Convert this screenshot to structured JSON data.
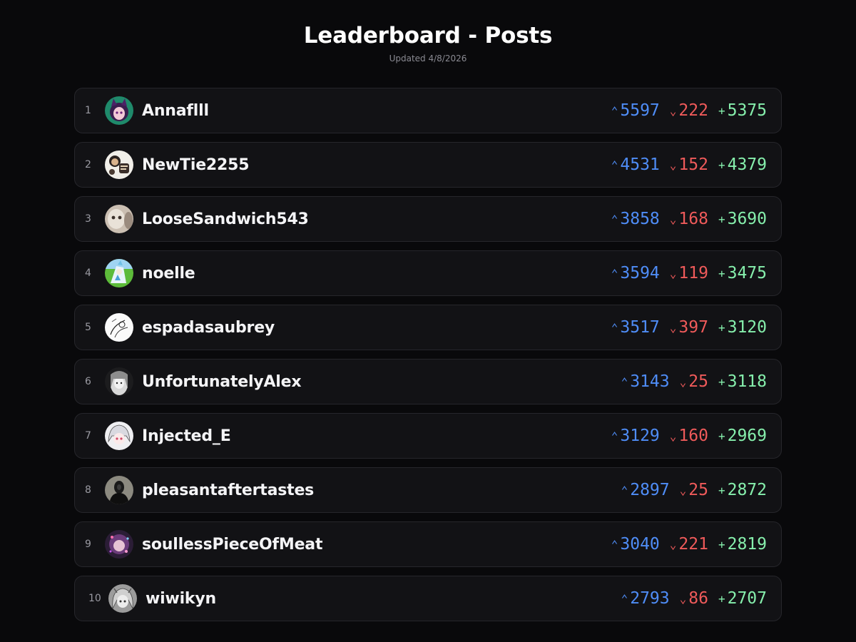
{
  "header": {
    "title": "Leaderboard - Posts",
    "updated": "Updated 4/8/2026"
  },
  "icons": {
    "up": "chevron-up-icon",
    "down": "chevron-down-icon",
    "net": "plus-icon"
  },
  "colors": {
    "background": "#09090b",
    "row_bg": "#121215",
    "upvote": "#4f8df7",
    "downvote": "#ef5a5a",
    "net": "#86efac"
  },
  "symbols": {
    "up": "⌃",
    "down": "⌄",
    "net": "+"
  },
  "entries": [
    {
      "rank": "1",
      "name": "Annaflll",
      "up": "5597",
      "down": "222",
      "net": "5375",
      "avatar": "anime-girl-purple-hair"
    },
    {
      "rank": "2",
      "name": "NewTie2255",
      "up": "4531",
      "down": "152",
      "net": "4379",
      "avatar": "sketch-character"
    },
    {
      "rank": "3",
      "name": "LooseSandwich543",
      "up": "3858",
      "down": "168",
      "net": "3690",
      "avatar": "cat-photo"
    },
    {
      "rank": "4",
      "name": "noelle",
      "up": "3594",
      "down": "119",
      "net": "3475",
      "avatar": "green-field-character"
    },
    {
      "rank": "5",
      "name": "espadasaubrey",
      "up": "3517",
      "down": "397",
      "net": "3120",
      "avatar": "line-art-sketch"
    },
    {
      "rank": "6",
      "name": "UnfortunatelyAlex",
      "up": "3143",
      "down": "25",
      "net": "3118",
      "avatar": "monochrome-girl"
    },
    {
      "rank": "7",
      "name": "Injected_E",
      "up": "3129",
      "down": "160",
      "net": "2969",
      "avatar": "white-hair-girl"
    },
    {
      "rank": "8",
      "name": "pleasantaftertastes",
      "up": "2897",
      "down": "25",
      "net": "2872",
      "avatar": "dark-figure"
    },
    {
      "rank": "9",
      "name": "soullessPieceOfMeat",
      "up": "3040",
      "down": "221",
      "net": "2819",
      "avatar": "pink-cosmic-character"
    },
    {
      "rank": "10",
      "name": "wiwikyn",
      "up": "2793",
      "down": "86",
      "net": "2707",
      "avatar": "grey-sketch-girl"
    }
  ]
}
